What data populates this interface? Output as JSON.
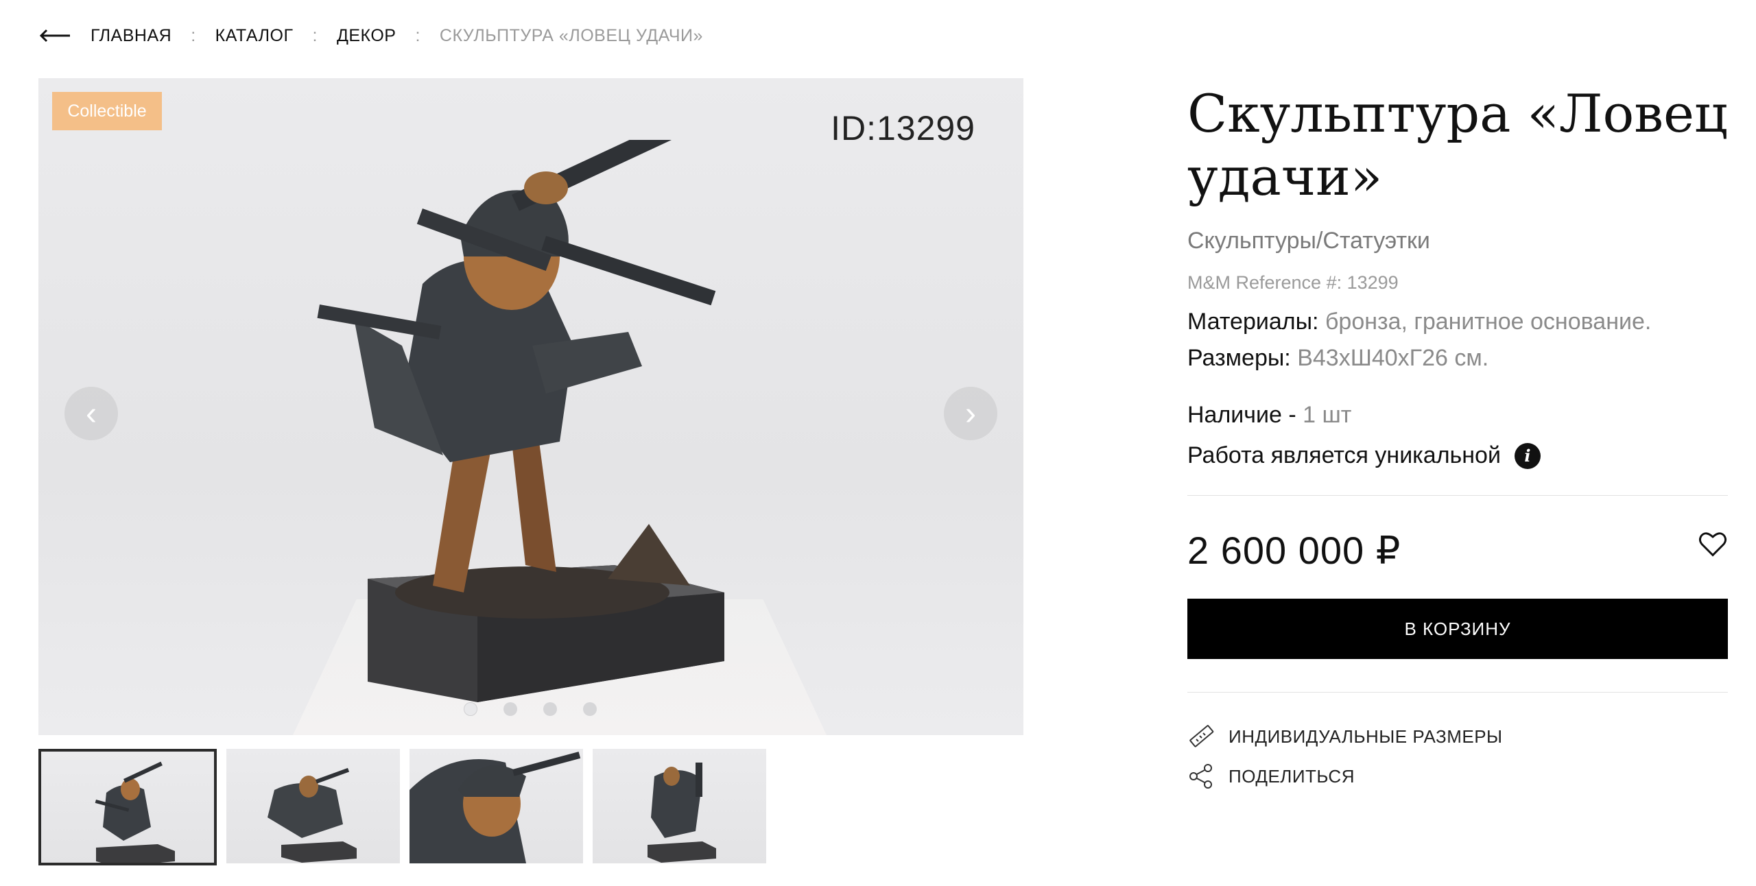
{
  "breadcrumb": {
    "items": [
      "ГЛАВНАЯ",
      "КАТАЛОГ",
      "ДЕКОР"
    ],
    "current": "СКУЛЬПТУРА «ЛОВЕЦ УДАЧИ»",
    "separator": ":"
  },
  "gallery": {
    "badge": "Collectible",
    "id_label": "ID:13299",
    "prev_icon": "chevron-left-icon",
    "next_icon": "chevron-right-icon",
    "prev_glyph": "‹",
    "next_glyph": "›",
    "slide_count": 4,
    "active_slide": 1,
    "thumbnail_count": 4
  },
  "product": {
    "title": "Скульптура «Ловец удачи»",
    "category": "Скульптуры/Статуэтки",
    "reference": "M&M Reference #: 13299",
    "materials_label": "Материалы:",
    "materials_value": "бронза, гранитное основание.",
    "sizes_label": "Размеры:",
    "sizes_value": "В43хШ40хГ26 см.",
    "availability_label": "Наличие -",
    "availability_value": "1 шт",
    "unique_text": "Работа является уникальной",
    "info_glyph": "i",
    "price": "2 600 000 ₽",
    "cart_button": "В КОРЗИНУ",
    "custom_sizes": "ИНДИВИДУАЛЬНЫЕ РАЗМЕРЫ",
    "share": "ПОДЕЛИТЬСЯ"
  },
  "colors": {
    "badge": "#f4bf88",
    "button": "#000000",
    "muted": "#8a8a8a"
  }
}
